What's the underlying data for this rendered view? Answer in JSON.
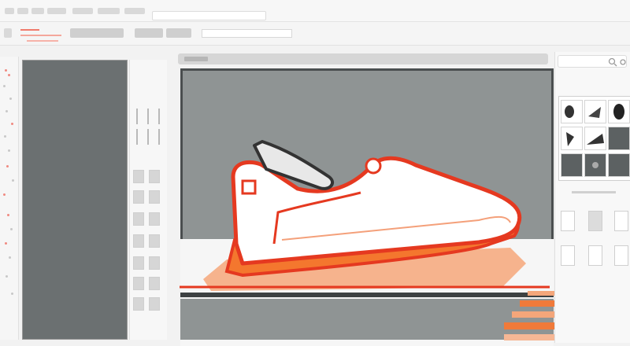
{
  "colors": {
    "accent": "#f05a28",
    "outline": "#e53920",
    "dark_panel": "#6b7071",
    "canvas_bg": "#8f9494",
    "sole_orange": "#f4772e"
  },
  "icons": {
    "canvas_tab": "canvas-tab-icon",
    "search": "search-icon",
    "gear": "gear-icon"
  }
}
